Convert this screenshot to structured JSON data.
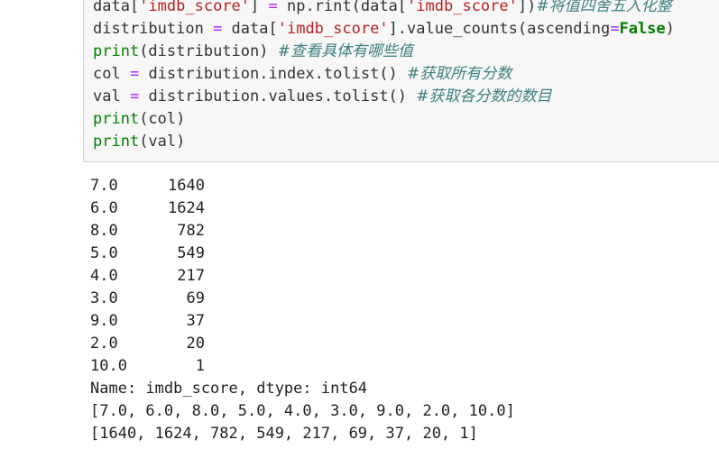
{
  "code": {
    "line1": {
      "a": "data[",
      "s1": "'imdb_score'",
      "b": "] ",
      "eq": "=",
      "c": " np.rint(data[",
      "s2": "'imdb_score'",
      "d": "])",
      "cm": "#将值四舍五入化整"
    },
    "line2": {
      "a": "distribution ",
      "eq": "=",
      "b": " data[",
      "s1": "'imdb_score'",
      "c": "].value_counts(ascending",
      "eq2": "=",
      "kw": "False",
      "d": ")"
    },
    "line3": {
      "fn": "print",
      "a": "(distribution) ",
      "cm": "#查看具体有哪些值"
    },
    "line4": {
      "a": "col ",
      "eq": "=",
      "b": " distribution.index.tolist() ",
      "cm": "#获取所有分数"
    },
    "line5": {
      "a": "val ",
      "eq": "=",
      "b": " distribution.values.tolist() ",
      "cm": "#获取各分数的数目"
    },
    "line6": {
      "fn": "print",
      "a": "(col)"
    },
    "line7": {
      "fn": "print",
      "a": "(val)"
    }
  },
  "output": {
    "value_counts": [
      {
        "index": "7.0",
        "count": "1640"
      },
      {
        "index": "6.0",
        "count": "1624"
      },
      {
        "index": "8.0",
        "count": "782"
      },
      {
        "index": "5.0",
        "count": "549"
      },
      {
        "index": "4.0",
        "count": "217"
      },
      {
        "index": "3.0",
        "count": "69"
      },
      {
        "index": "9.0",
        "count": "37"
      },
      {
        "index": "2.0",
        "count": "20"
      },
      {
        "index": "10.0",
        "count": "1"
      }
    ],
    "series_info": "Name: imdb_score, dtype: int64",
    "col_list": "[7.0, 6.0, 8.0, 5.0, 4.0, 3.0, 9.0, 2.0, 10.0]",
    "val_list": "[1640, 1624, 782, 549, 217, 69, 37, 20, 1]"
  }
}
